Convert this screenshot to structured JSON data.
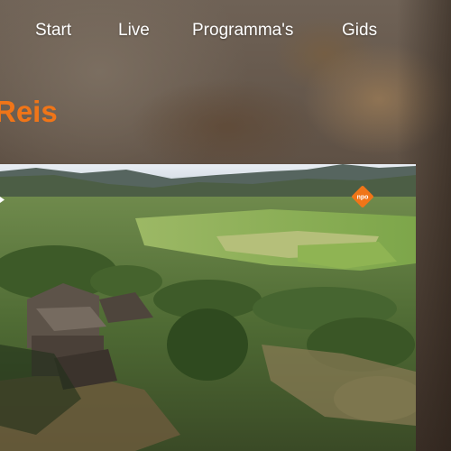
{
  "nav": {
    "items": [
      {
        "label": "Start"
      },
      {
        "label": "Live"
      },
      {
        "label": "Programma's"
      },
      {
        "label": "Gids"
      }
    ]
  },
  "page": {
    "title": "Reis"
  },
  "player": {
    "logo_icon": "npo-logo-icon",
    "accent_color": "#f07518"
  },
  "colors": {
    "title": "#f07518",
    "nav_text": "#ffffff"
  }
}
